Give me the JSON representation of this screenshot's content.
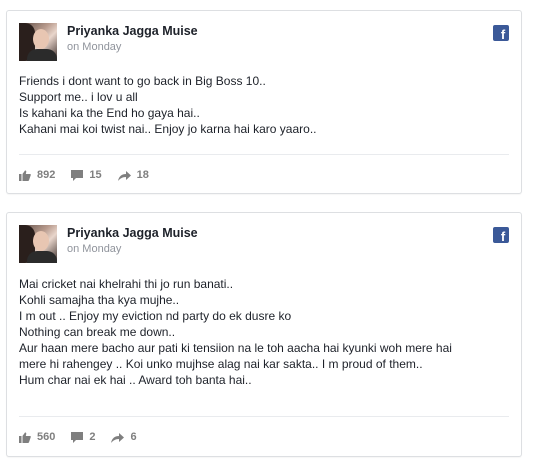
{
  "posts": [
    {
      "author": "Priyanka Jagga Muise",
      "date": "on Monday",
      "lines": [
        "Friends i dont want to go back in Big Boss 10..",
        "Support me.. i lov u all",
        "Is kahani ka the End ho gaya hai..",
        "Kahani mai koi twist nai.. Enjoy jo karna hai karo yaaro.."
      ],
      "likes": "892",
      "comments": "15",
      "shares": "18"
    },
    {
      "author": "Priyanka Jagga Muise",
      "date": "on Monday",
      "lines": [
        "Mai cricket nai khelrahi thi jo run banati..",
        "Kohli samajha tha kya mujhe..",
        "I m out .. Enjoy my eviction nd party do ek dusre ko",
        "Nothing can break me down..",
        "Aur haan mere bacho aur pati ki tensiion na le toh aacha hai kyunki woh mere hai",
        "mere hi rahengey .. Koi unko mujhse alag nai kar sakta.. I m proud of them..",
        "Hum char nai ek hai .. Award toh banta hai.."
      ],
      "likes": "560",
      "comments": "2",
      "shares": "6"
    }
  ],
  "icons": {
    "network": "facebook-icon",
    "like": "thumbs-up-icon",
    "comment": "comment-bubble-icon",
    "share": "share-arrow-icon"
  },
  "colors": {
    "facebook_blue": "#3b5998",
    "stat_gray": "#7f7f7f",
    "date_gray": "#90949c"
  }
}
